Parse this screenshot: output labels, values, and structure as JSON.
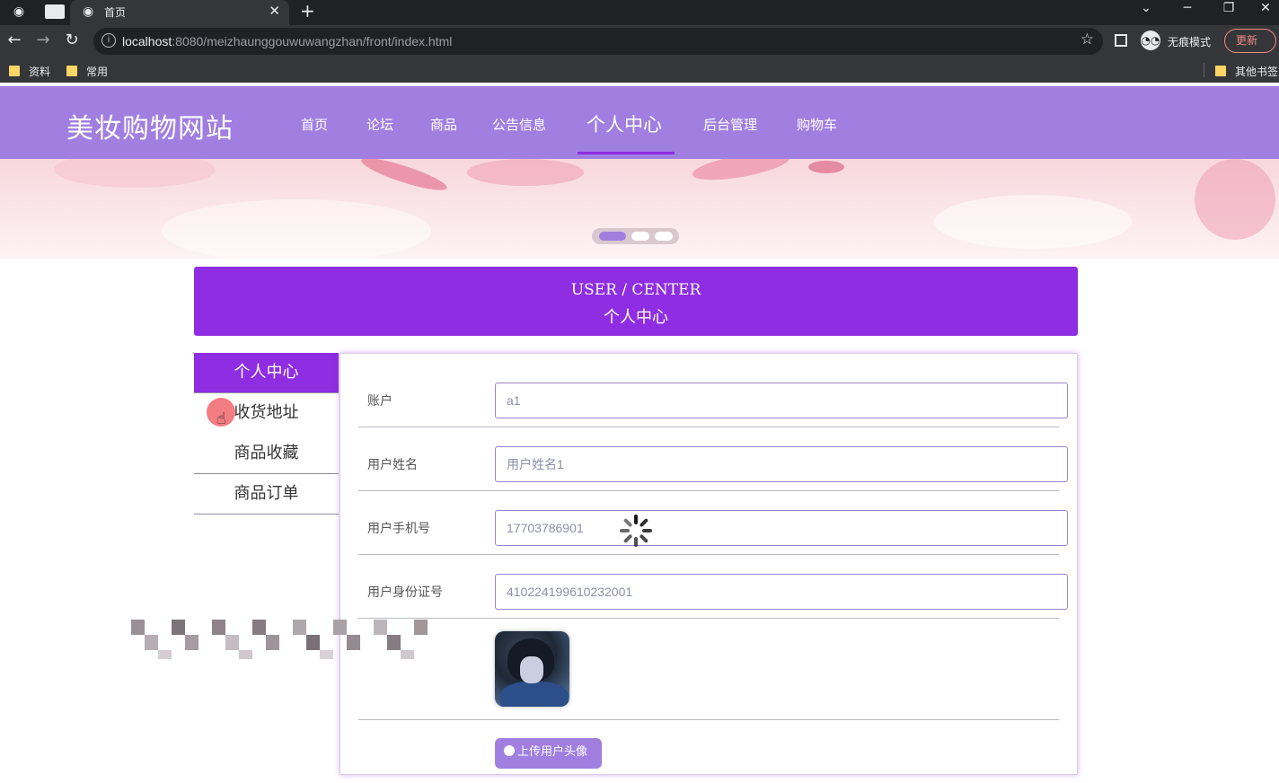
{
  "browser": {
    "tab_title": "首页",
    "url_host": "localhost",
    "url_rest": ":8080/meizhaunggouwuwangzhan/front/index.html",
    "incognito_label": "无痕模式",
    "update_label": "更新",
    "bookmarks": [
      "资料",
      "常用"
    ],
    "other_bookmarks": "其他书签"
  },
  "site": {
    "logo": "美妆购物网站",
    "nav": [
      "首页",
      "论坛",
      "商品",
      "公告信息",
      "个人中心",
      "后台管理",
      "购物车"
    ],
    "active_nav_index": 4
  },
  "banner": {
    "slides": 3,
    "active_slide": 0
  },
  "center_title": {
    "en": "USER / CENTER",
    "cn": "个人中心"
  },
  "side_menu": [
    "个人中心",
    "收货地址",
    "商品收藏",
    "商品订单"
  ],
  "form": {
    "fields": [
      {
        "label": "账户",
        "value": "a1"
      },
      {
        "label": "用户姓名",
        "value": "用户姓名1"
      },
      {
        "label": "用户手机号",
        "value": "17703786901"
      },
      {
        "label": "用户身份证号",
        "value": "410224199610232001"
      }
    ],
    "upload_label": "上传用户头像"
  },
  "colors": {
    "header": "#a17fe0",
    "accent": "#8e2de2"
  }
}
